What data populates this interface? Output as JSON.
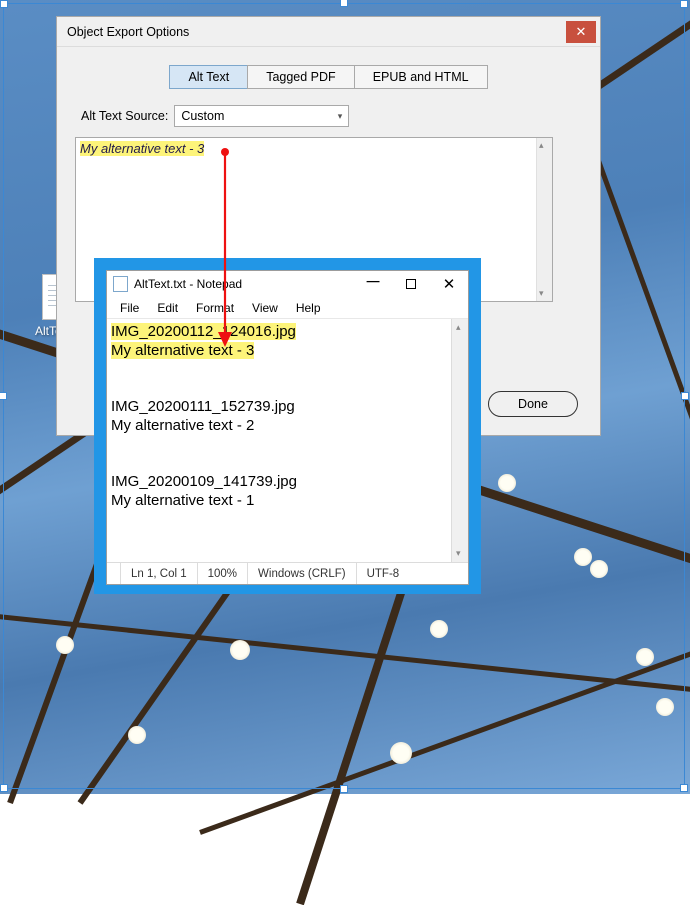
{
  "export": {
    "title": "Object Export Options",
    "tabs": {
      "alt": "Alt Text",
      "tagged": "Tagged PDF",
      "epub": "EPUB and HTML"
    },
    "altLabel": "Alt Text Source:",
    "altSource": "Custom",
    "altContent": "My alternative text - 3",
    "done": "Done"
  },
  "notepad": {
    "title": "AltText.txt - Notepad",
    "menu": {
      "file": "File",
      "edit": "Edit",
      "format": "Format",
      "view": "View",
      "help": "Help"
    },
    "line1": "IMG_20200112_124016.jpg",
    "line2": "My alternative text - 3",
    "line3": "IMG_20200111_152739.jpg",
    "line4": "My alternative text - 2",
    "line5": "IMG_20200109_141739.jpg",
    "line6": "My alternative text - 1",
    "status": {
      "pos": "Ln 1, Col 1",
      "zoom": "100%",
      "eol": "Windows (CRLF)",
      "enc": "UTF-8"
    }
  },
  "desktop": {
    "filename": "AltText.txt"
  }
}
